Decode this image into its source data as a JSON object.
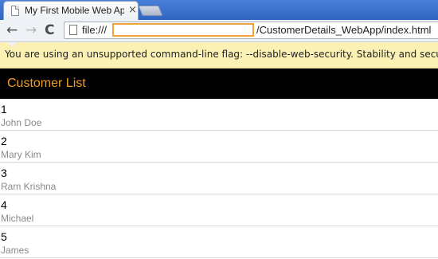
{
  "browser": {
    "tab_title": "My First Mobile Web App",
    "tab_close": "×",
    "url_scheme": "file:///",
    "url_path": "/CustomerDetails_WebApp/index.html",
    "nav": {
      "back": "←",
      "forward": "→",
      "reload": "C"
    }
  },
  "infobar": {
    "message": "You are using an unsupported command-line flag: --disable-web-security. Stability and security will suffer."
  },
  "app": {
    "title": "Customer List",
    "accent_color": "#f29d1e",
    "customers": [
      {
        "id": "1",
        "name": "John Doe"
      },
      {
        "id": "2",
        "name": "Mary Kim"
      },
      {
        "id": "3",
        "name": "Ram Krishna"
      },
      {
        "id": "4",
        "name": "Michael"
      },
      {
        "id": "5",
        "name": "James"
      }
    ]
  }
}
